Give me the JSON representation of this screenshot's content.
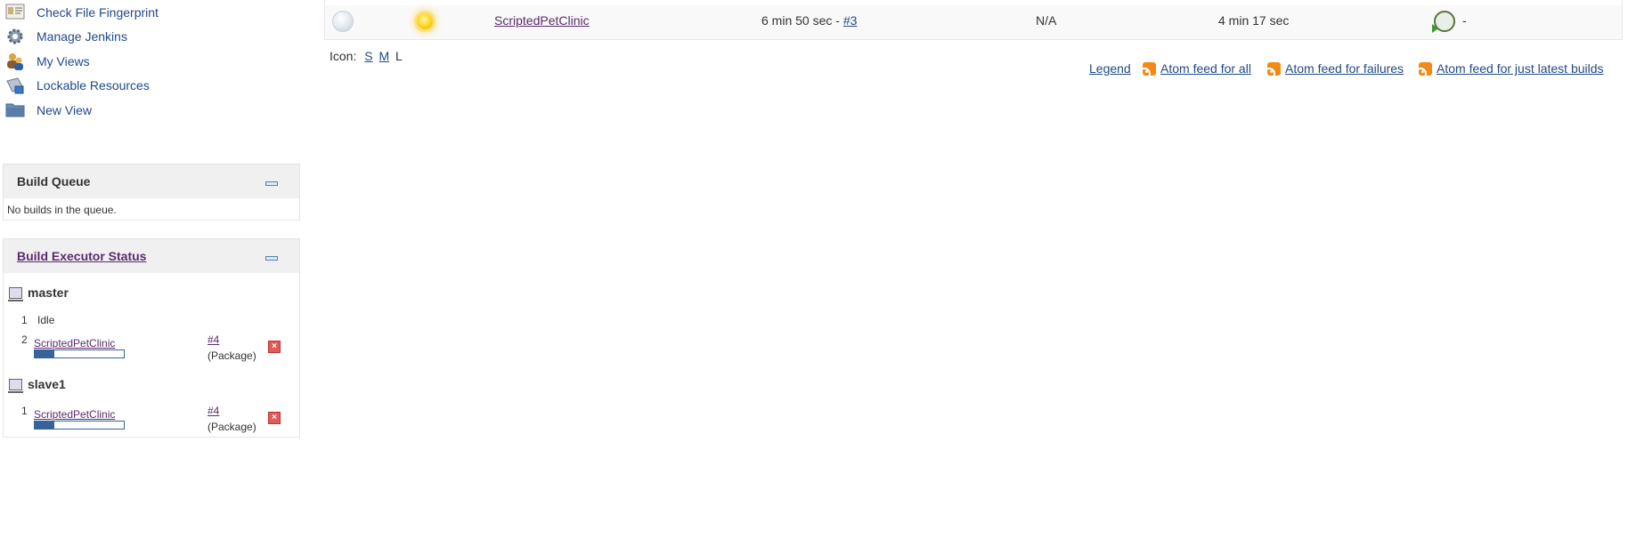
{
  "sidebar": {
    "tasks": [
      {
        "label": "Check File Fingerprint",
        "icon": "fingerprint-icon"
      },
      {
        "label": "Manage Jenkins",
        "icon": "gear-icon"
      },
      {
        "label": "My Views",
        "icon": "user-group-icon"
      },
      {
        "label": "Lockable Resources",
        "icon": "lock-resources-icon"
      },
      {
        "label": "New View",
        "icon": "folder-icon"
      }
    ],
    "build_queue": {
      "title": "Build Queue",
      "empty_text": "No builds in the queue."
    },
    "executor_status": {
      "title": "Build Executor Status",
      "nodes": [
        {
          "name": "master",
          "executors": [
            {
              "number": "1",
              "state": "Idle"
            },
            {
              "number": "2",
              "job": "ScriptedPetClinic",
              "build": "#4",
              "stage": "(Package)",
              "progress": 0.22
            }
          ]
        },
        {
          "name": "slave1",
          "executors": [
            {
              "number": "1",
              "job": "ScriptedPetClinic",
              "build": "#4",
              "stage": "(Package)",
              "progress": 0.22
            }
          ]
        }
      ]
    }
  },
  "jobs_table": {
    "rows": [
      {
        "status_icon": "grey-ball-icon",
        "weather_icon": "sunny-icon",
        "name": "ScriptedPetClinic",
        "last_success_prefix": "6 min 50 sec - ",
        "last_success_build": "#3",
        "last_failure": "N/A",
        "last_duration": "4 min 17 sec",
        "schedule_icon": "clock-icon",
        "schedule_text": "-"
      }
    ]
  },
  "icon_size": {
    "label": "Icon:",
    "options": [
      "S",
      "M",
      "L"
    ]
  },
  "footer": {
    "legend": "Legend",
    "feed_all": "Atom feed for all",
    "feed_failures": "Atom feed for failures",
    "feed_latest": "Atom feed for just latest builds"
  },
  "colors": {
    "link": "#204A87",
    "visited_link": "#5a2b6e",
    "progress": "#36639c",
    "feed": "#f28a1b",
    "stop": "#e05a5a"
  }
}
